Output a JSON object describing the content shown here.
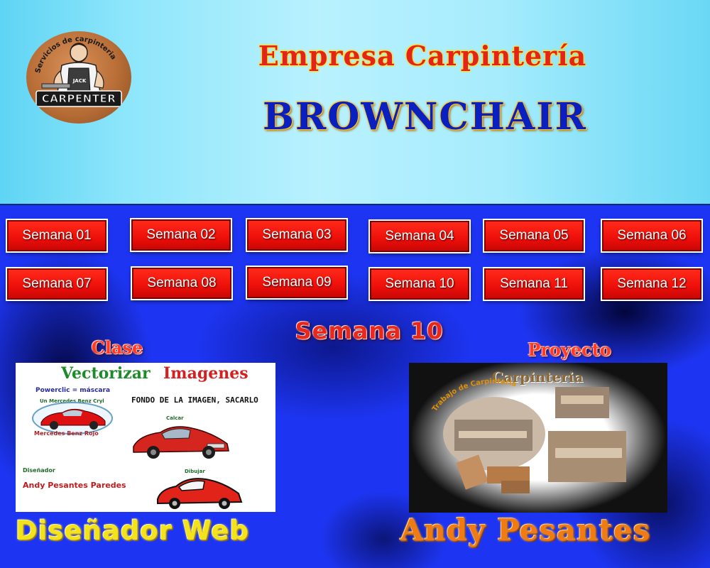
{
  "header": {
    "logo": {
      "text": "CARPENTER",
      "apron_text": "JACK",
      "arc_text": "Servicios de carpinteria"
    },
    "title_top": "Empresa Carpintería",
    "title_main": "BROWNCHAIR"
  },
  "weeks": [
    "Semana 01",
    "Semana 02",
    "Semana 03",
    "Semana 04",
    "Semana 05",
    "Semana 06",
    "Semana 07",
    "Semana 08",
    "Semana 09",
    "Semana 10",
    "Semana 11",
    "Semana 12"
  ],
  "current_week": "Semana 10",
  "class_section": {
    "label": "Clase",
    "card": {
      "title_part1": "Vectorizar",
      "title_part2": "Imagenes",
      "note_tool": "Powerclic = máscara",
      "note_car": "Un Mercedes Benz Cryl",
      "car_caption": "Mercedes Benz Rojo",
      "note_bg": "FONDO DE LA IMAGEN, SACARLO",
      "step_calcar": "Calcar",
      "role": "Diseñador",
      "designer": "Andy Pesantes Paredes",
      "step_dibujar": "Dibujar"
    }
  },
  "project_section": {
    "label": "Proyecto",
    "card": {
      "title": "Carpinteria",
      "arc_text": "Trabajo de Carpinteria"
    }
  },
  "footer": {
    "left": "Diseñador Web",
    "right": "Andy Pesantes"
  },
  "colors": {
    "button_red": "#ee0f0a",
    "main_blue": "#1d35f2",
    "header_cyan": "#a6ecfd"
  }
}
